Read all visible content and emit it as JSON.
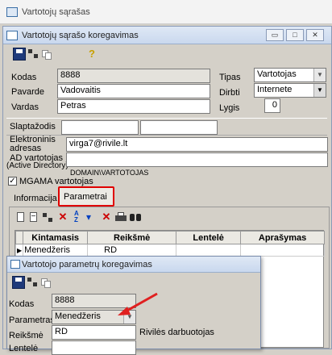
{
  "outer_window": {
    "title": "Vartotojų sąrašas"
  },
  "edit_window": {
    "title": "Vartotojų sąrašo koregavimas",
    "sys_buttons": [
      "▭",
      "□",
      "✕"
    ],
    "fields": {
      "kodas_label": "Kodas",
      "kodas_value": "8888",
      "pavarde_label": "Pavarde",
      "pavarde_value": "Vadovaitis",
      "vardas_label": "Vardas",
      "vardas_value": "Petras",
      "slaptazodis_label": "Slaptažodis",
      "email_label_1": "Elektroninis",
      "email_label_2": "adresas",
      "email_value": "virga7@rivile.lt",
      "ad_label_1": "AD vartotojas",
      "ad_label_2": "(Active Directory)",
      "ad_value": "DOMAIN\\VARTOTOJAS",
      "mgama_label": "MGAMA vartotojas",
      "tipas_label": "Tipas",
      "tipas_value": "Vartotojas",
      "dirbti_label": "Dirbti",
      "dirbti_value": "Internete",
      "lygis_label": "Lygis",
      "lygis_value": "0"
    },
    "tabs": {
      "info": "Informacija",
      "params": "Parametrai"
    },
    "grid": {
      "headers": [
        "Kintamasis",
        "Reikšmė",
        "Lentelė",
        "Aprašymas"
      ],
      "rows": [
        [
          "Menedžeris",
          "RD",
          "",
          ""
        ]
      ]
    }
  },
  "param_window": {
    "title": "Vartotojo parametrų koregavimas",
    "kodas_label": "Kodas",
    "kodas_value": "8888",
    "parametras_label": "Parametras",
    "parametras_value": "Menedžeris",
    "reiksme_label": "Reikšmė",
    "reiksme_value": "RD",
    "reiksme_desc": "Rivilės darbuotojas",
    "lentele_label": "Lentelė"
  },
  "colors": {
    "highlight_red": "#e00000",
    "arrow_red": "#e02020"
  }
}
